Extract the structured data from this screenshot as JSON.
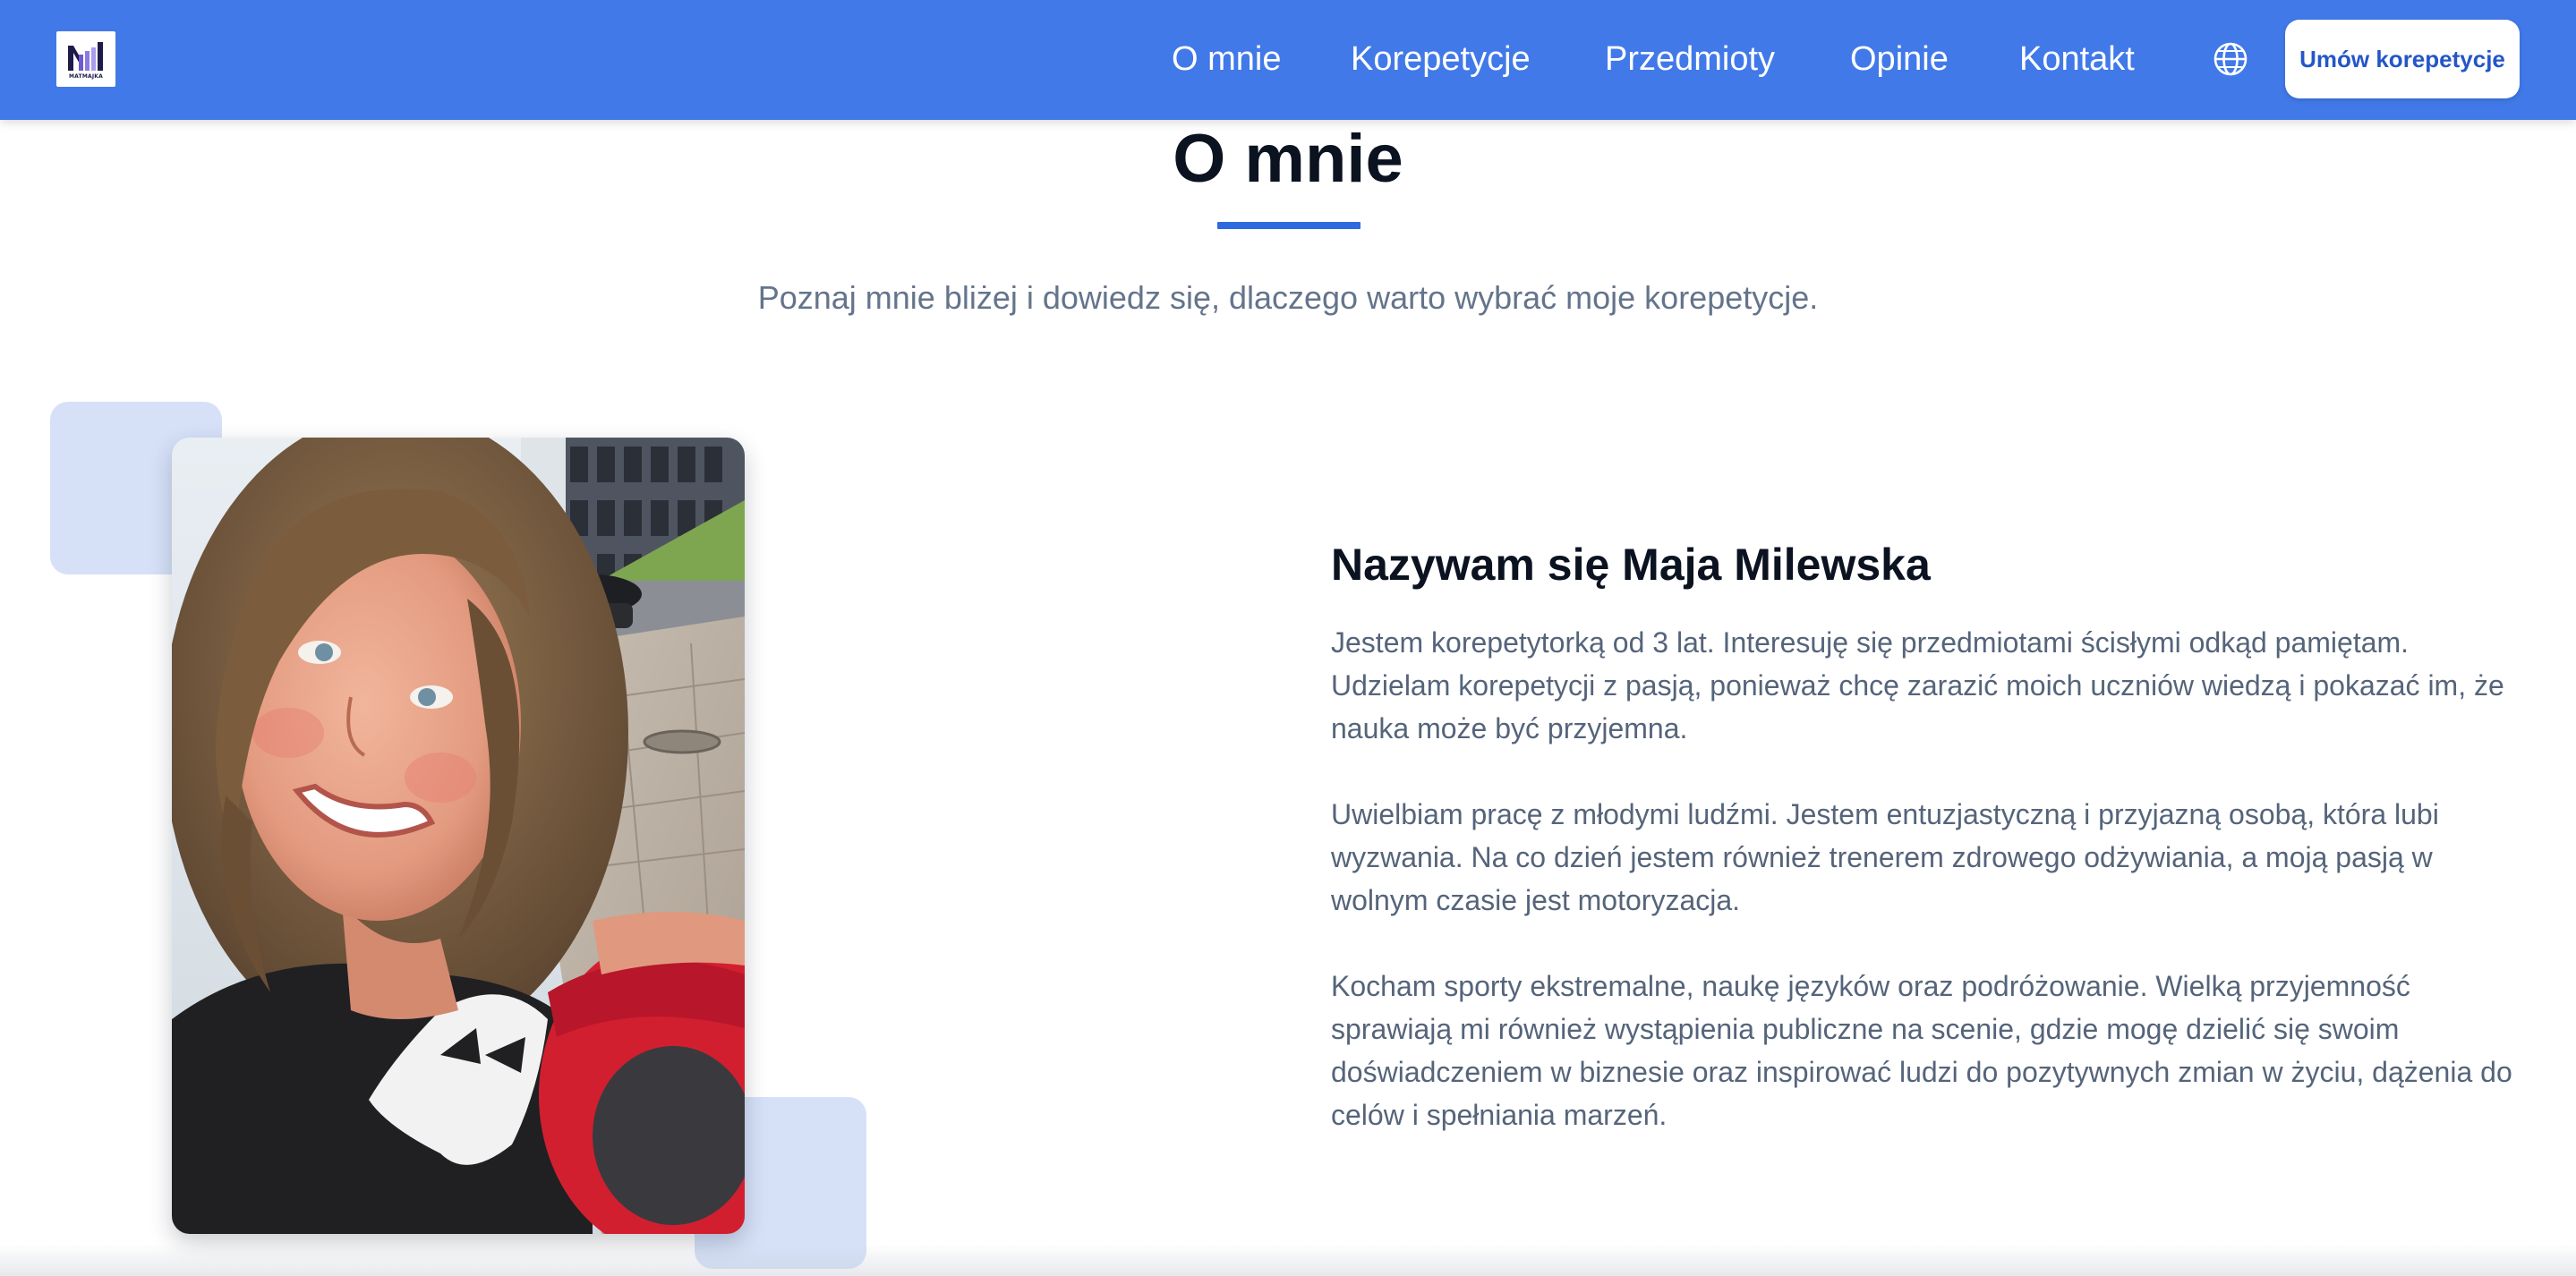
{
  "navbar": {
    "background_color": "#4179e9",
    "logo_text": "MATMAJKA",
    "links": [
      "O mnie",
      "Korepetycje",
      "Przedmioty",
      "Opinie",
      "Kontakt"
    ],
    "language_icon": "globe-icon",
    "cta_label": "Umów korepetycje"
  },
  "section": {
    "title": "O mnie",
    "subtitle": "Poznaj mnie bliżej i dowiedz się, dlaczego warto wybrać moje korepetycje.",
    "accent_color": "#2f6be0"
  },
  "profile": {
    "photo": "profile-photo",
    "heading": "Nazywam się Maja Milewska",
    "paragraphs": [
      "Jestem korepetytorką od 3 lat. Interesuję się przedmiotami ścisłymi odkąd pamiętam. Udzielam korepetycji z pasją, ponieważ chcę zarazić moich uczniów wiedzą i pokazać im, że nauka może być przyjemna.",
      "Uwielbiam pracę z młodymi ludźmi. Jestem entuzjastyczną i przyjazną osobą, która lubi wyzwania. Na co dzień jestem również trenerem zdrowego odżywiania, a moją pasją w wolnym czasie jest motoryzacja.",
      "Kocham sporty ekstremalne, naukę języków oraz podróżowanie. Wielką przyjemność sprawiają mi również wystąpienia publiczne na scenie, gdzie mogę dzielić się swoim doświadczeniem w biznesie oraz inspirować ludzi do pozytywnych zmian w życiu, dążenia do celów i spełniania marzeń."
    ]
  }
}
